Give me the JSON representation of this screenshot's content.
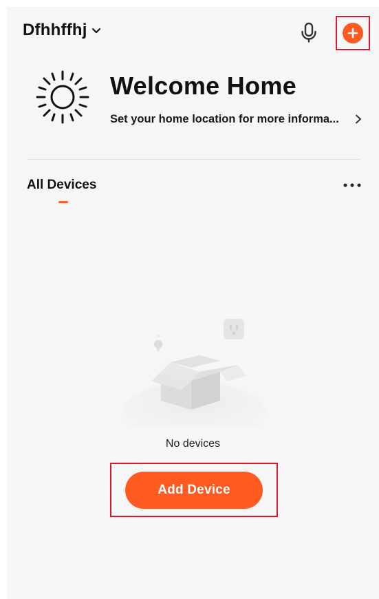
{
  "header": {
    "home_name": "Dfhhffhj",
    "home_switch_icon": "chevron-down-icon",
    "mic_icon": "microphone-icon",
    "add_icon": "plus-circle-icon"
  },
  "welcome": {
    "icon": "sun-icon",
    "title": "Welcome Home",
    "subtitle": "Set your home location for more informa...",
    "subtitle_icon": "chevron-right-icon"
  },
  "tabs": {
    "active_label": "All Devices",
    "more_icon": "more-horizontal-icon"
  },
  "empty_state": {
    "illustration": "empty-box-illustration",
    "message": "No devices",
    "add_button_label": "Add Device"
  },
  "colors": {
    "accent": "#ff5a21",
    "highlight_box": "#d7192b",
    "background": "#f6f6f6"
  }
}
